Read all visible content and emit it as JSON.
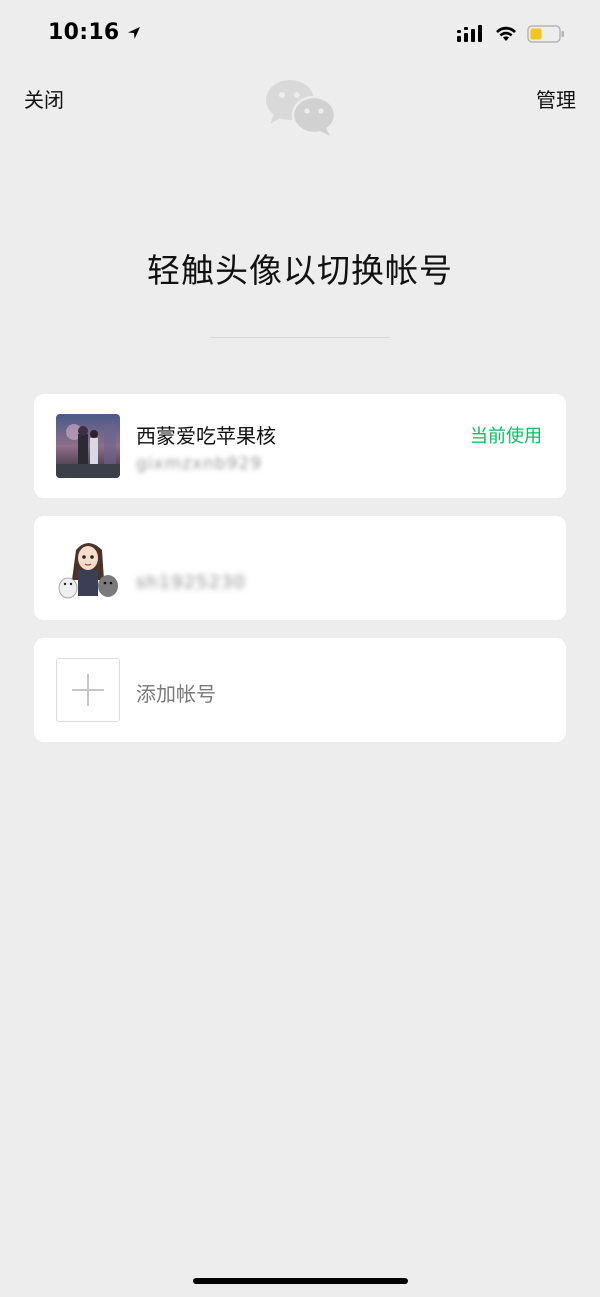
{
  "status_bar": {
    "time": "10:16",
    "icons": [
      "location-arrow-icon",
      "cellular-signal-icon",
      "wifi-icon",
      "battery-icon"
    ],
    "battery_color": "#f5c518"
  },
  "nav": {
    "close_label": "关闭",
    "manage_label": "管理",
    "logo_icon": "wechat-logo-icon"
  },
  "title": "轻触头像以切换帐号",
  "accounts": [
    {
      "name": "西蒙爱吃苹果核",
      "id": "gixmzxnb929",
      "status": "当前使用",
      "avatar_icon": "photo-avatar"
    },
    {
      "name": "",
      "id": "sh1925230",
      "avatar_icon": "cartoon-girl-avatar"
    }
  ],
  "add_account": {
    "label": "添加帐号",
    "icon": "plus-icon"
  },
  "colors": {
    "background": "#ededed",
    "card": "#ffffff",
    "accent_green": "#07c160"
  }
}
